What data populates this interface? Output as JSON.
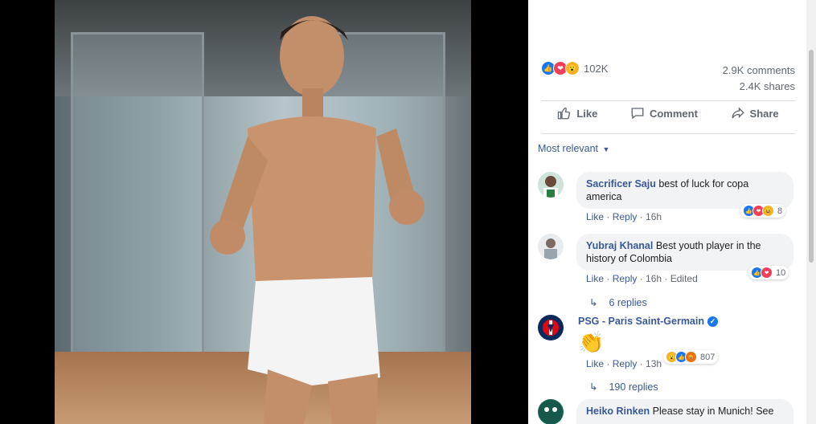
{
  "post": {
    "reactions_count": "102K",
    "comments_count": "2.9K comments",
    "shares_count": "2.4K shares"
  },
  "actions": {
    "like": "Like",
    "comment": "Comment",
    "share": "Share"
  },
  "sort_label": "Most relevant",
  "comments": [
    {
      "author": "Sacrificer Saju",
      "text": "best of luck for copa america",
      "like": "Like",
      "reply": "Reply",
      "time": "16h",
      "reactions": "8"
    },
    {
      "author": "Yubraj Khanal",
      "text": "Best youth player in the history of Colombia",
      "like": "Like",
      "reply": "Reply",
      "time": "16h",
      "edited": "Edited",
      "reactions": "10",
      "replies": "6 replies"
    },
    {
      "author": "PSG - Paris Saint-Germain",
      "text": "👏",
      "like": "Like",
      "reply": "Reply",
      "time": "13h",
      "reactions": "807",
      "replies": "190 replies"
    },
    {
      "author": "Heiko Rinken",
      "text": "Please stay in Munich! See"
    }
  ],
  "icons": {
    "like": "thumbs-up-icon",
    "comment": "speech-bubble-icon",
    "share": "share-arrow-icon",
    "dropdown": "caret-down-icon",
    "reply_arrow": "reply-arrow-icon",
    "verified": "verified-check-icon"
  },
  "colors": {
    "link": "#385898",
    "like": "#1877f2",
    "love": "#f33e58",
    "bubble": "#f2f3f5"
  }
}
